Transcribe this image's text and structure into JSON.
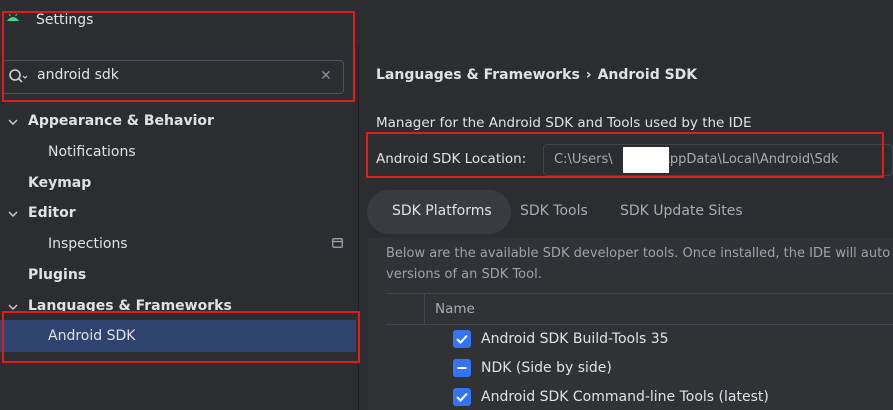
{
  "window": {
    "title": "Settings"
  },
  "search": {
    "value": "android sdk",
    "clear_glyph": "✕"
  },
  "tree": [
    {
      "label": "Appearance & Behavior",
      "bold": true,
      "expandable": true
    },
    {
      "label": "Notifications",
      "bold": false,
      "expandable": false
    },
    {
      "label": "Keymap",
      "bold": true,
      "expandable": false
    },
    {
      "label": "Editor",
      "bold": true,
      "expandable": true
    },
    {
      "label": "Inspections",
      "bold": false,
      "expandable": false
    },
    {
      "label": "Plugins",
      "bold": true,
      "expandable": false
    },
    {
      "label": "Languages & Frameworks",
      "bold": true,
      "expandable": true
    },
    {
      "label": "Android SDK",
      "bold": false,
      "expandable": false,
      "selected": true
    }
  ],
  "breadcrumb": {
    "parent": "Languages & Frameworks",
    "separator": "›",
    "current": "Android SDK"
  },
  "description": "Manager for the Android SDK and Tools used by the IDE",
  "sdk_location": {
    "label": "Android SDK Location:",
    "value_prefix": "C:\\Users\\",
    "value_suffix": "\\AppData\\Local\\Android\\Sdk"
  },
  "tabs": [
    "SDK Platforms",
    "SDK Tools",
    "SDK Update Sites"
  ],
  "info": {
    "line1": "Below are the available SDK developer tools. Once installed, the IDE will auto",
    "line2": "versions of an SDK Tool."
  },
  "table": {
    "header": "Name",
    "rows": [
      {
        "label": "Android SDK Build-Tools 35",
        "state": "checked"
      },
      {
        "label": "NDK (Side by side)",
        "state": "partial"
      },
      {
        "label": "Android SDK Command-line Tools (latest)",
        "state": "checked"
      }
    ]
  },
  "colors": {
    "background": "#2b2d30",
    "selection": "#2e436e",
    "accent": "#3574f0",
    "annotation": "#e01b1b"
  }
}
